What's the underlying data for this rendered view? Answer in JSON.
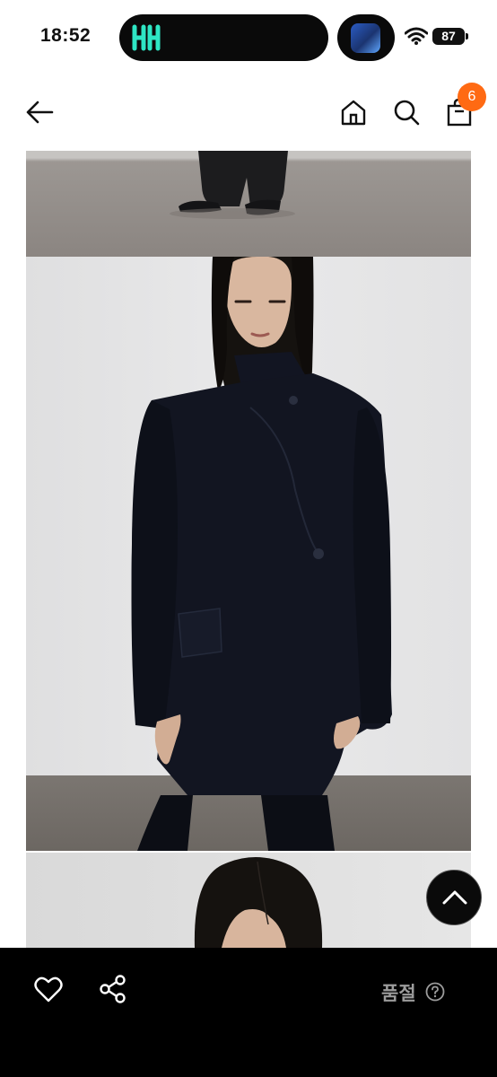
{
  "status_bar": {
    "time": "18:52",
    "battery": "87",
    "icons": [
      "app-logo-icon",
      "app-thumbnail-icon",
      "wifi-icon",
      "battery-icon"
    ]
  },
  "header": {
    "icons": [
      "back-arrow-icon",
      "home-icon",
      "search-icon",
      "shopping-bag-icon"
    ],
    "cart_count": "6"
  },
  "gallery": {
    "images": [
      "model-shoes-floor-photo",
      "model-black-coat-photo",
      "model-face-photo"
    ]
  },
  "scroll_top": {
    "icon": "chevron-up-icon"
  },
  "bottom_bar": {
    "icons": [
      "heart-icon",
      "share-icon",
      "help-circle-icon"
    ],
    "status_label": "품절"
  },
  "colors": {
    "badge": "#ff6a13",
    "bottom_bar": "#000000",
    "sold_out_text": "#9c9c9c",
    "coat": "#111521"
  }
}
